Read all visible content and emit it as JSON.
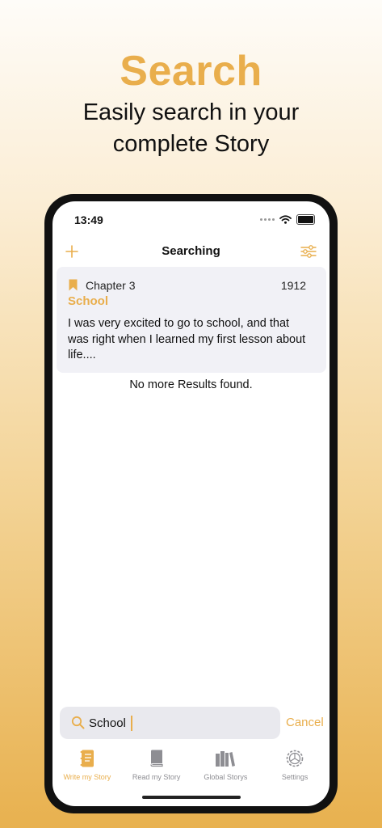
{
  "promo": {
    "title": "Search",
    "subtitle_line1": "Easily search in your",
    "subtitle_line2": "complete Story"
  },
  "colors": {
    "accent": "#e9ae4c",
    "card_bg": "#f1f1f6",
    "search_bg": "#e9e9ee",
    "inactive": "#8e8e93"
  },
  "status": {
    "time": "13:49"
  },
  "nav": {
    "title": "Searching",
    "left_icon": "plus-icon",
    "right_icon": "filter-sliders-icon"
  },
  "result": {
    "chapter": "Chapter 3",
    "year": "1912",
    "title": "School",
    "excerpt": "I was very excited to go to school, and that was right when I learned my first lesson about life...."
  },
  "no_more": "No more Results found.",
  "search": {
    "value": "School",
    "cancel_label": "Cancel"
  },
  "tabs": [
    {
      "label": "Write my Story",
      "icon": "notebook-icon",
      "active": true
    },
    {
      "label": "Read my Story",
      "icon": "book-icon",
      "active": false
    },
    {
      "label": "Global Storys",
      "icon": "books-icon",
      "active": false
    },
    {
      "label": "Settings",
      "icon": "gear-icon",
      "active": false
    }
  ]
}
